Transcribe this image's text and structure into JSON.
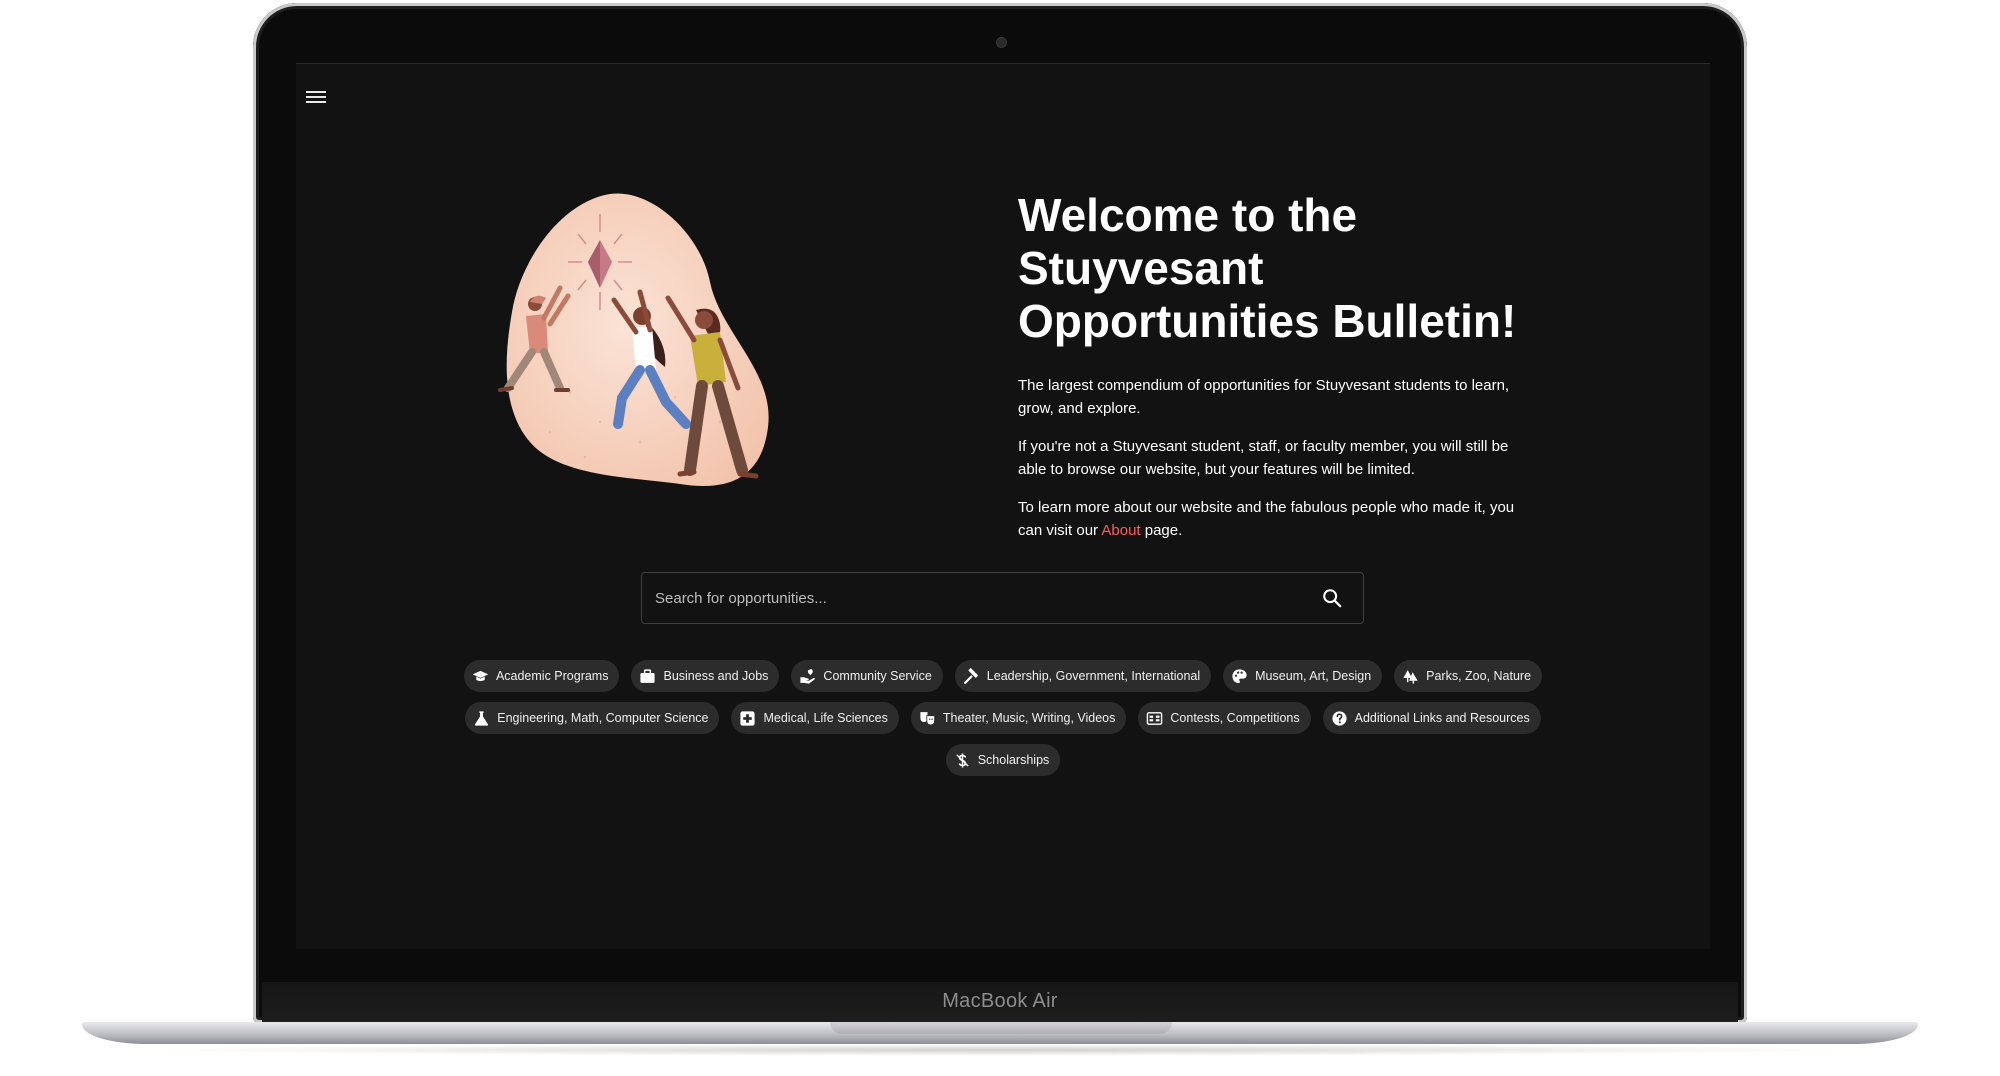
{
  "device": {
    "brand": "MacBook Air"
  },
  "nav": {
    "menu_icon": "menu-icon"
  },
  "hero": {
    "title_line1": "Welcome to the",
    "title_line2": "Stuyvesant",
    "title_line3": "Opportunities Bulletin!",
    "para1": "The largest compendium of opportunities for Stuyvesant students to learn, grow, and explore.",
    "para2": "If you're not a Stuyvesant student, staff, or faculty member, you will still be able to browse our website, but your features will be limited.",
    "para3_before": "To learn more about our website and the fabulous people who made it, you can visit our ",
    "para3_link": "About",
    "para3_after": " page."
  },
  "search": {
    "placeholder": "Search for opportunities...",
    "value": "",
    "icon": "search-icon"
  },
  "categories": [
    {
      "label": "Academic Programs",
      "icon": "graduation-cap-icon"
    },
    {
      "label": "Business and Jobs",
      "icon": "briefcase-icon"
    },
    {
      "label": "Community Service",
      "icon": "hand-heart-icon"
    },
    {
      "label": "Leadership, Government, International",
      "icon": "gavel-icon"
    },
    {
      "label": "Museum, Art, Design",
      "icon": "palette-icon"
    },
    {
      "label": "Parks, Zoo, Nature",
      "icon": "trees-icon"
    },
    {
      "label": "Engineering, Math, Computer Science",
      "icon": "flask-icon"
    },
    {
      "label": "Medical, Life Sciences",
      "icon": "medical-cross-icon"
    },
    {
      "label": "Theater, Music, Writing, Videos",
      "icon": "theater-masks-icon"
    },
    {
      "label": "Contests, Competitions",
      "icon": "scoreboard-icon"
    },
    {
      "label": "Additional Links and Resources",
      "icon": "question-circle-icon"
    },
    {
      "label": "Scholarships",
      "icon": "dollar-slash-icon"
    }
  ],
  "colors": {
    "background": "#121212",
    "link": "#ff5a5f",
    "chip": "#2c2c2c",
    "blob": "#f6cdb9"
  }
}
